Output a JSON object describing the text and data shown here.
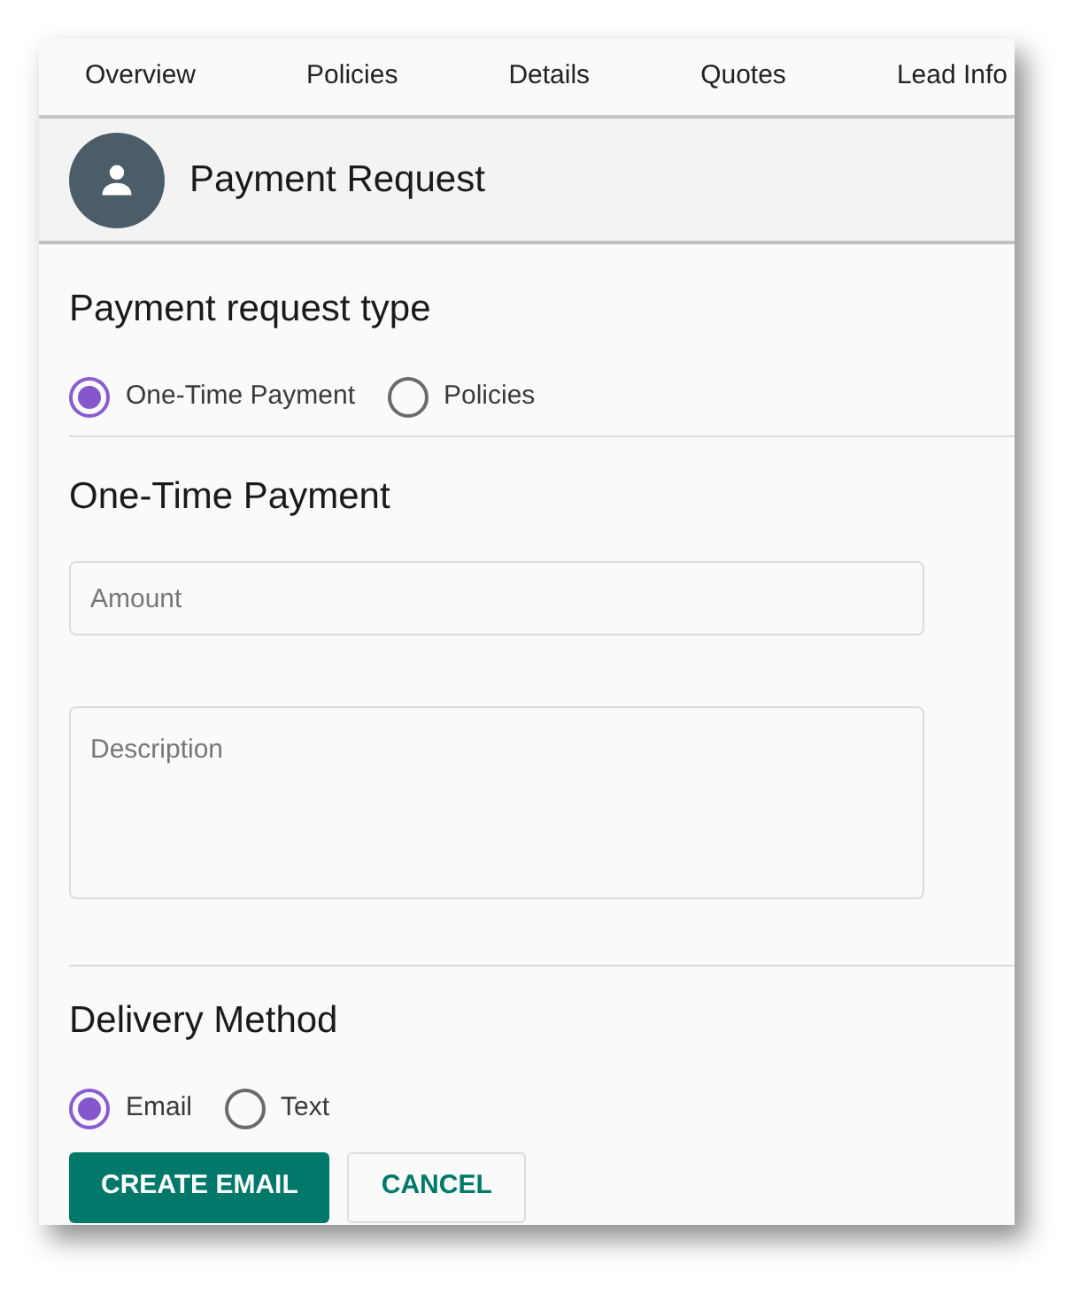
{
  "tabs": [
    {
      "label": "Overview"
    },
    {
      "label": "Policies"
    },
    {
      "label": "Details"
    },
    {
      "label": "Quotes"
    },
    {
      "label": "Lead Info"
    }
  ],
  "header": {
    "title": "Payment Request"
  },
  "request_type": {
    "title": "Payment request type",
    "options": [
      {
        "label": "One-Time Payment",
        "selected": true
      },
      {
        "label": "Policies",
        "selected": false
      }
    ]
  },
  "one_time_payment": {
    "title": "One-Time Payment",
    "amount": {
      "placeholder": "Amount"
    },
    "description": {
      "placeholder": "Description"
    }
  },
  "delivery": {
    "title": "Delivery Method",
    "options": [
      {
        "label": "Email",
        "selected": true
      },
      {
        "label": "Text",
        "selected": false
      }
    ]
  },
  "buttons": [
    {
      "label": "CREATE EMAIL",
      "kind": "primary"
    },
    {
      "label": "CANCEL",
      "kind": "secondary"
    }
  ]
}
